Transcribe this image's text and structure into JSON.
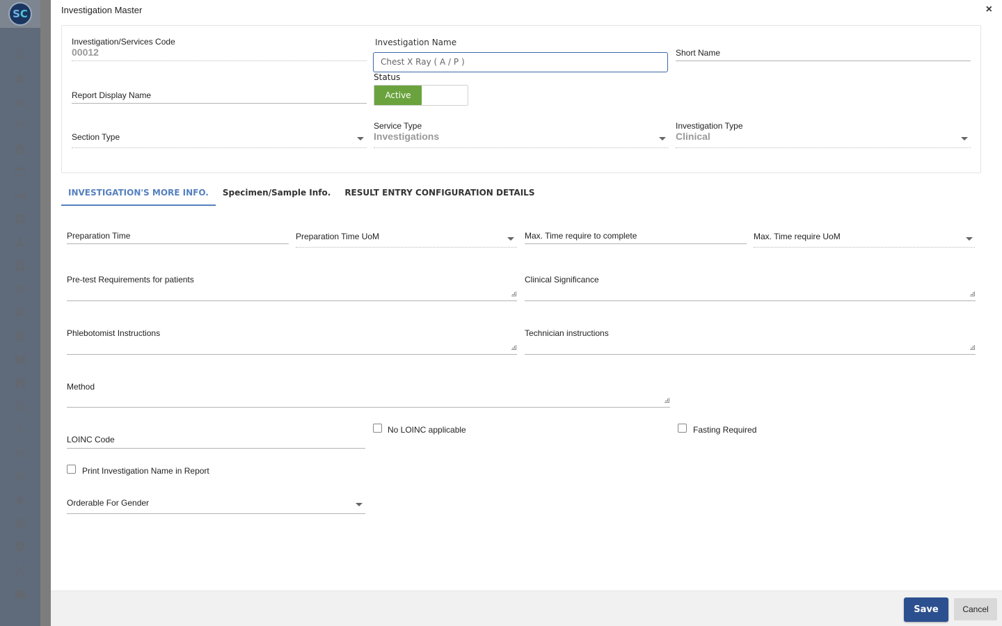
{
  "modal": {
    "title": "Investigation Master",
    "close_glyph": "×"
  },
  "top": {
    "code_label": "Investigation/Services Code",
    "code_value": "00012",
    "name_label": "Investigation Name",
    "name_value": "Chest X Ray ( A / P )",
    "short_name_label": "Short Name",
    "report_display_label": "Report Display Name",
    "status_label": "Status",
    "status_value": "Active",
    "section_type_label": "Section Type",
    "service_type_label": "Service Type",
    "service_type_value": "Investigations",
    "investigation_type_label": "Investigation Type",
    "investigation_type_value": "Clinical"
  },
  "tabs": [
    {
      "label": "INVESTIGATION'S MORE INFO.",
      "active": true
    },
    {
      "label": "Specimen/Sample Info.",
      "active": false
    },
    {
      "label": "RESULT ENTRY CONFIGURATION DETAILS",
      "active": false
    }
  ],
  "form": {
    "prep_time_label": "Preparation Time",
    "prep_time_uom_label": "Preparation Time UoM",
    "max_time_label": "Max. Time require to complete",
    "max_time_uom_label": "Max. Time require UoM",
    "pretest_label": "Pre-test Requirements for patients",
    "clinical_significance_label": "Clinical Significance",
    "phlebotomist_label": "Phlebotomist Instructions",
    "technician_label": "Technician instructions",
    "method_label": "Method",
    "loinc_label": "LOINC Code",
    "no_loinc_label": "No LOINC applicable",
    "fasting_label": "Fasting Required",
    "print_name_label": "Print Investigation Name in Report",
    "gender_label": "Orderable For Gender"
  },
  "footer": {
    "save_label": "Save",
    "cancel_label": "Cancel"
  },
  "sidebar": {
    "logo_s": "S",
    "logo_c": "C",
    "icons": [
      "search-icon",
      "home-icon",
      "bar-chart-icon",
      "menu-icon",
      "medical-bag-icon",
      "calendar-icon",
      "bed-icon",
      "plus-box-icon",
      "person-icon",
      "document-icon",
      "list-icon",
      "lab-icon",
      "pharmacy-icon",
      "book-icon",
      "building-icon",
      "devices-icon",
      "wrench-icon",
      "menu-icon",
      "menu-icon",
      "drop-icon",
      "add-box-icon",
      "shield-icon",
      "network-icon",
      "folder-icon"
    ]
  },
  "colors": {
    "sidebar": "#1f3b66",
    "accent": "#5580bf",
    "active_toggle": "#6aa33d",
    "save_button": "#2c4f8f"
  }
}
